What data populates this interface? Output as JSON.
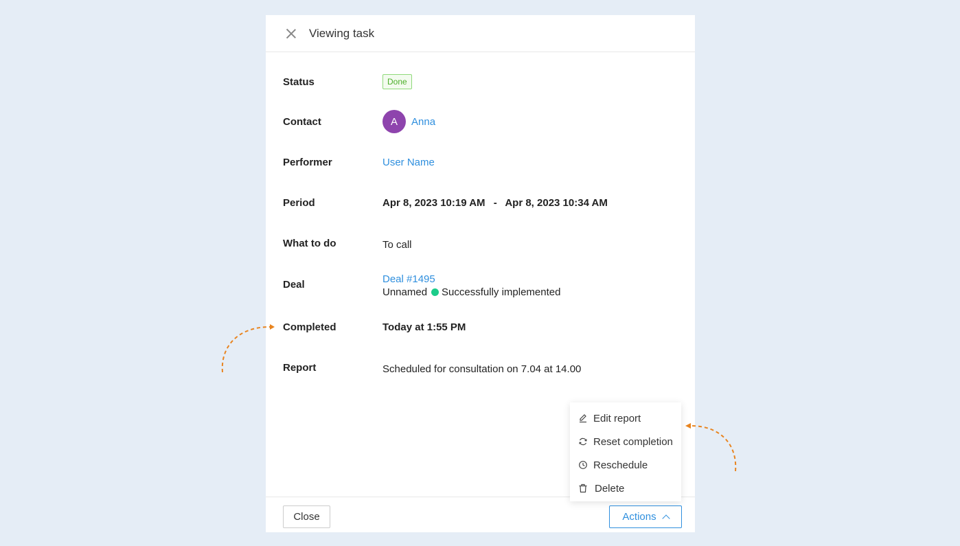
{
  "modal": {
    "title": "Viewing task"
  },
  "fields": {
    "status": {
      "label": "Status",
      "value": "Done"
    },
    "contact": {
      "label": "Contact",
      "avatar_letter": "A",
      "name": "Anna",
      "avatar_color": "#8e44ad"
    },
    "performer": {
      "label": "Performer",
      "value": "User Name"
    },
    "period": {
      "label": "Period",
      "start": "Apr 8, 2023 10:19 AM",
      "separator": "-",
      "end": "Apr 8, 2023 10:34 AM"
    },
    "what_to_do": {
      "label": "What to do",
      "value": "To call"
    },
    "deal": {
      "label": "Deal",
      "link": "Deal #1495",
      "name": "Unnamed",
      "stage": "Successfully implemented",
      "stage_color": "#1ccc8a"
    },
    "completed": {
      "label": "Completed",
      "value": "Today at 1:55 PM"
    },
    "report": {
      "label": "Report",
      "value": "Scheduled for consultation on 7.04 at 14.00"
    }
  },
  "footer": {
    "close_label": "Close",
    "actions_label": "Actions"
  },
  "actions_menu": {
    "items": [
      {
        "label": "Edit report",
        "icon": "pencil-icon"
      },
      {
        "label": "Reset completion",
        "icon": "refresh-icon"
      },
      {
        "label": "Reschedule",
        "icon": "clock-icon"
      },
      {
        "label": "Delete",
        "icon": "trash-icon"
      }
    ]
  },
  "colors": {
    "background": "#e5edf6",
    "accent": "#2f8fde",
    "arrow": "#e8841f",
    "badge_green": "#4caf2a"
  }
}
